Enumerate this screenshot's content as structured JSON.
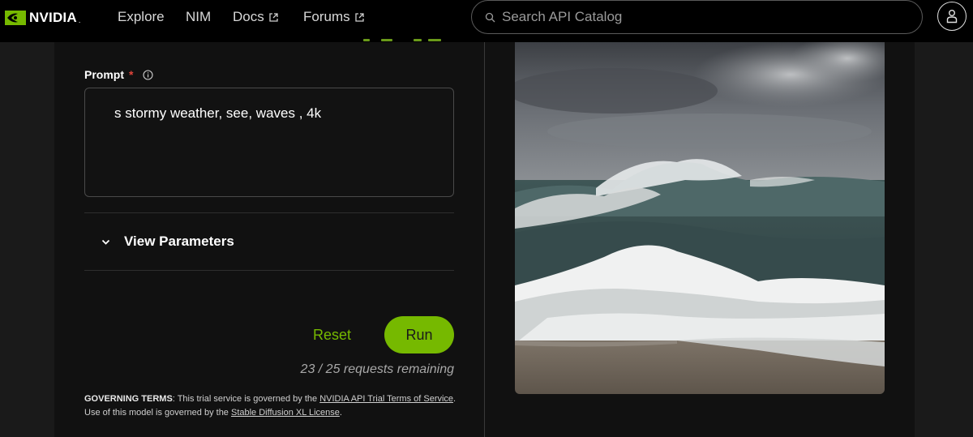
{
  "header": {
    "logo_text": "NVIDIA",
    "logo_mark": ".",
    "nav": [
      {
        "label": "Explore",
        "external": false
      },
      {
        "label": "NIM",
        "external": false
      },
      {
        "label": "Docs",
        "external": true
      },
      {
        "label": "Forums",
        "external": true
      }
    ],
    "search_placeholder": "Search API Catalog"
  },
  "form": {
    "prompt_label": "Prompt",
    "required_mark": "*",
    "prompt_value": "s stormy weather, see, waves , 4k",
    "params_label": "View Parameters",
    "reset_label": "Reset",
    "run_label": "Run",
    "requests_remaining": "23 / 25 requests remaining"
  },
  "terms": {
    "heading": "GOVERNING TERMS",
    "text1": ": This trial service is governed by the ",
    "link1": "NVIDIA API Trial Terms of Service",
    "text2": ". Use of this model is governed by the ",
    "link2": "Stable Diffusion XL License",
    "text3": "."
  },
  "output": {
    "image_subject": "stormy-sea-waves"
  },
  "colors": {
    "accent": "#76b900",
    "required": "#e0443a",
    "background": "#111111"
  }
}
